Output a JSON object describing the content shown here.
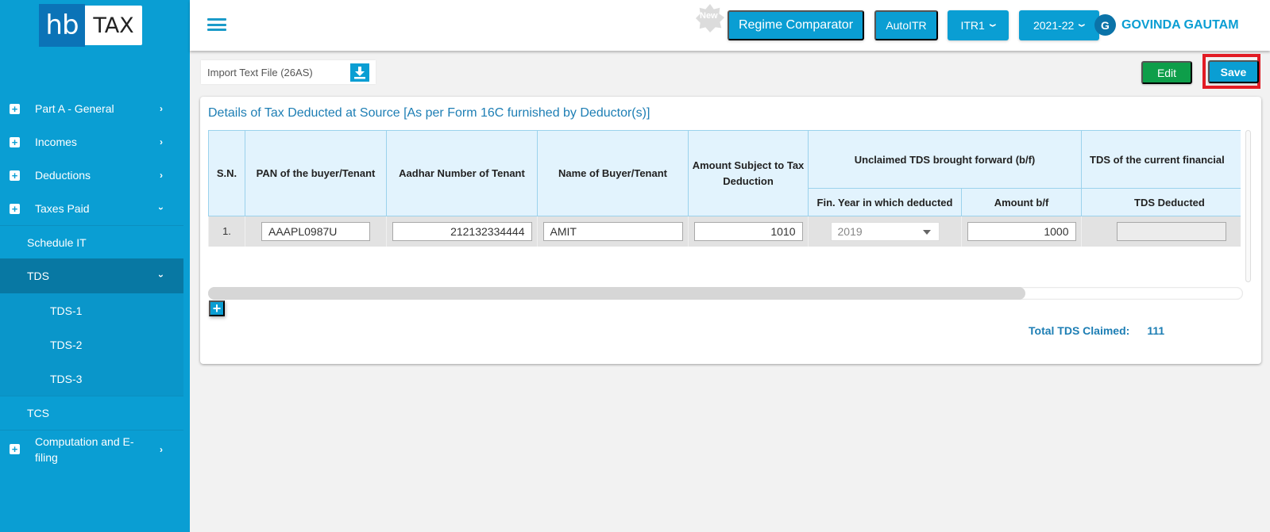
{
  "logo": {
    "left": "hb",
    "right": "TAX"
  },
  "sidebar": {
    "items": [
      {
        "label": "Part A - General",
        "expanded": false
      },
      {
        "label": "Incomes",
        "expanded": false
      },
      {
        "label": "Deductions",
        "expanded": false
      },
      {
        "label": "Taxes Paid",
        "expanded": true
      },
      {
        "label": "Schedule IT"
      },
      {
        "label": "TDS",
        "expanded": true,
        "active": true
      },
      {
        "label": "TDS-1"
      },
      {
        "label": "TDS-2"
      },
      {
        "label": "TDS-3",
        "selected": true
      },
      {
        "label": "TCS"
      },
      {
        "label": "Computation and E-filing",
        "expanded": false
      }
    ]
  },
  "topbar": {
    "new_badge": "New",
    "regime_comparator": "Regime Comparator",
    "auto_itr": "AutoITR",
    "form": "ITR1",
    "year": "2021-22",
    "user_initial": "G",
    "user_name": "GOVINDA GAUTAM"
  },
  "toolbar": {
    "import_label": "Import Text File (26AS)",
    "edit_label": "Edit",
    "save_label": "Save"
  },
  "card": {
    "title": "Details of Tax Deducted at Source [As per Form 16C furnished by Deductor(s)]",
    "table": {
      "headers": {
        "sn": "S.N.",
        "pan": "PAN of the buyer/Tenant",
        "aadhar": "Aadhar Number of Tenant",
        "name": "Name of Buyer/Tenant",
        "amount_subject": "Amount Subject to Tax Deduction",
        "unclaimed_group": "Unclaimed TDS brought forward (b/f)",
        "fin_year": "Fin. Year in which deducted",
        "amount_bf": "Amount b/f",
        "current_group": "TDS of the current financial",
        "tds_deducted": "TDS Deducted"
      },
      "rows": [
        {
          "sn": "1.",
          "pan": "AAAPL0987U",
          "aadhar": "212132334444",
          "name": "AMIT",
          "amount_subject": "1010",
          "fin_year": "2019",
          "amount_bf": "1000",
          "tds_deducted": ""
        }
      ]
    },
    "scroll_position_fraction": 0.79,
    "total_label": "Total TDS Claimed:",
    "total_value": "111"
  },
  "colors": {
    "primary": "#0a9ed3",
    "sidebar_active": "#0878a3",
    "edit_green": "#0e9e4a",
    "highlight_red": "#e21b24",
    "title_blue": "#1d7eb4"
  }
}
